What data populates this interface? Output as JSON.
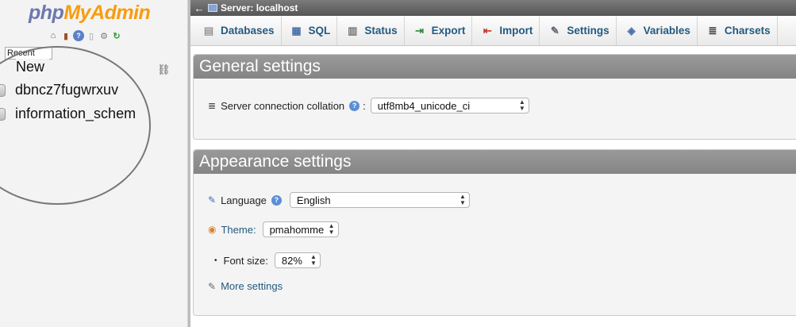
{
  "sidebar": {
    "logo_php": "php",
    "logo_myadmin": "MyAdmin",
    "recent_label": "Recent",
    "tree": {
      "new_label": "New",
      "databases": [
        "dbncz7fugwrxuv",
        "information_schem"
      ]
    }
  },
  "topbar": {
    "back": "←",
    "breadcrumb": "Server: localhost"
  },
  "tabs": [
    {
      "label": "Databases"
    },
    {
      "label": "SQL"
    },
    {
      "label": "Status"
    },
    {
      "label": "Export"
    },
    {
      "label": "Import"
    },
    {
      "label": "Settings"
    },
    {
      "label": "Variables"
    },
    {
      "label": "Charsets"
    }
  ],
  "general": {
    "title": "General settings",
    "collation_label": "Server connection collation",
    "collation_value": "utf8mb4_unicode_ci"
  },
  "appearance": {
    "title": "Appearance settings",
    "language_label": "Language",
    "language_value": "English",
    "theme_label": "Theme:",
    "theme_value": "pmahomme",
    "fontsize_label": "Font size:",
    "fontsize_value": "82%",
    "more_settings": "More settings"
  },
  "colors": {
    "accent": "#235a81",
    "logo_php": "#6c78af",
    "logo_myadmin": "#f89c0e",
    "panel_header": "#8d8d8d"
  }
}
